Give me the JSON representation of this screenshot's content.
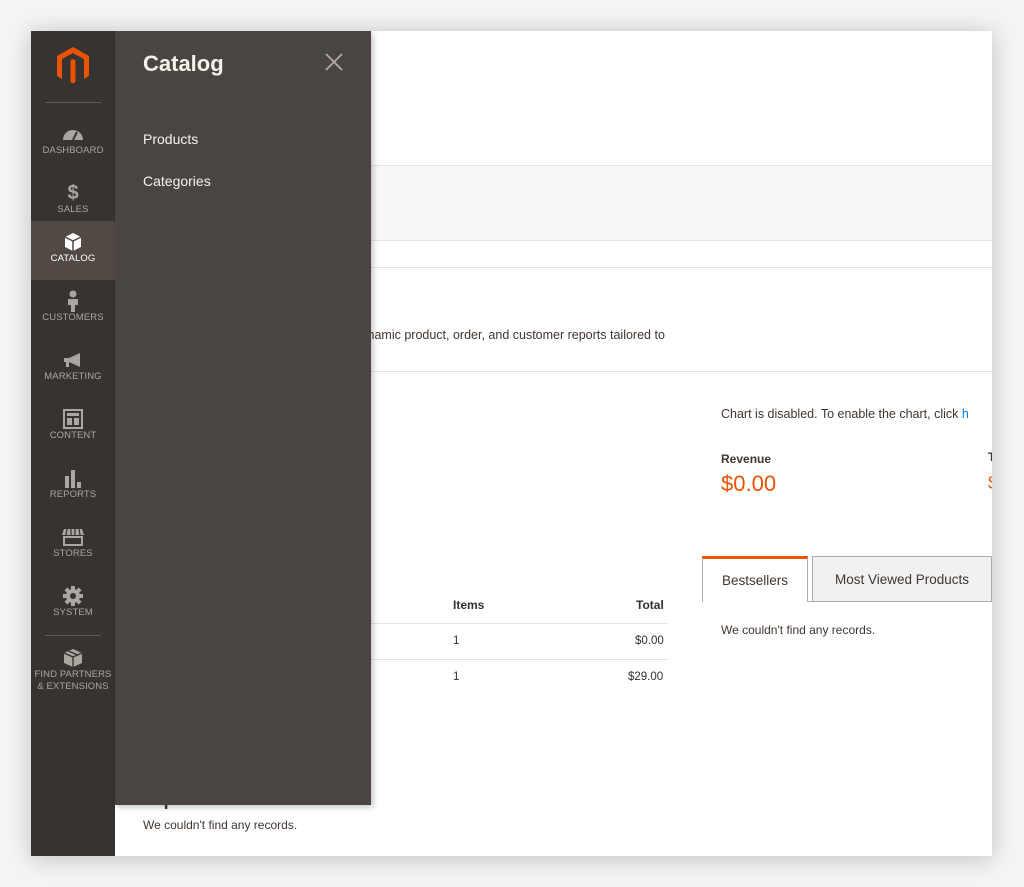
{
  "nav": {
    "items": [
      {
        "label": "DASHBOARD",
        "icon": "dashboard-icon"
      },
      {
        "label": "SALES",
        "icon": "dollar-icon"
      },
      {
        "label": "CATALOG",
        "icon": "box-icon",
        "active": true
      },
      {
        "label": "CUSTOMERS",
        "icon": "person-icon"
      },
      {
        "label": "MARKETING",
        "icon": "megaphone-icon"
      },
      {
        "label": "CONTENT",
        "icon": "layout-icon"
      },
      {
        "label": "REPORTS",
        "icon": "bar-chart-icon"
      },
      {
        "label": "STORES",
        "icon": "store-icon"
      },
      {
        "label": "SYSTEM",
        "icon": "gear-icon"
      }
    ],
    "partners": {
      "line1": "FIND PARTNERS",
      "line2": "& EXTENSIONS"
    }
  },
  "flyout": {
    "title": "Catalog",
    "links": [
      "Products",
      "Categories"
    ]
  },
  "dashboard": {
    "intro": "d of your business' performance, using our dynamic product, order, and customer reports tailored to",
    "chart_note": "Chart is disabled. To enable the chart, click ",
    "chart_note_link": "h",
    "revenue_label": "Revenue",
    "revenue_value": "$0.00",
    "clipped_label": "T",
    "clipped_value": "$"
  },
  "tabs": {
    "active": "Bestsellers",
    "inactive": "Most Viewed Products",
    "empty": "We couldn't find any records."
  },
  "orders_table": {
    "headers": {
      "items": "Items",
      "total": "Total"
    },
    "rows": [
      {
        "items": "1",
        "total": "$0.00"
      },
      {
        "items": "1",
        "total": "$29.00"
      }
    ]
  },
  "search_terms": {
    "title": "Top Search Terms",
    "empty": "We couldn't find any records."
  },
  "colors": {
    "accent": "#eb5202",
    "sidebar": "#373330",
    "flyout": "#4a4542"
  }
}
